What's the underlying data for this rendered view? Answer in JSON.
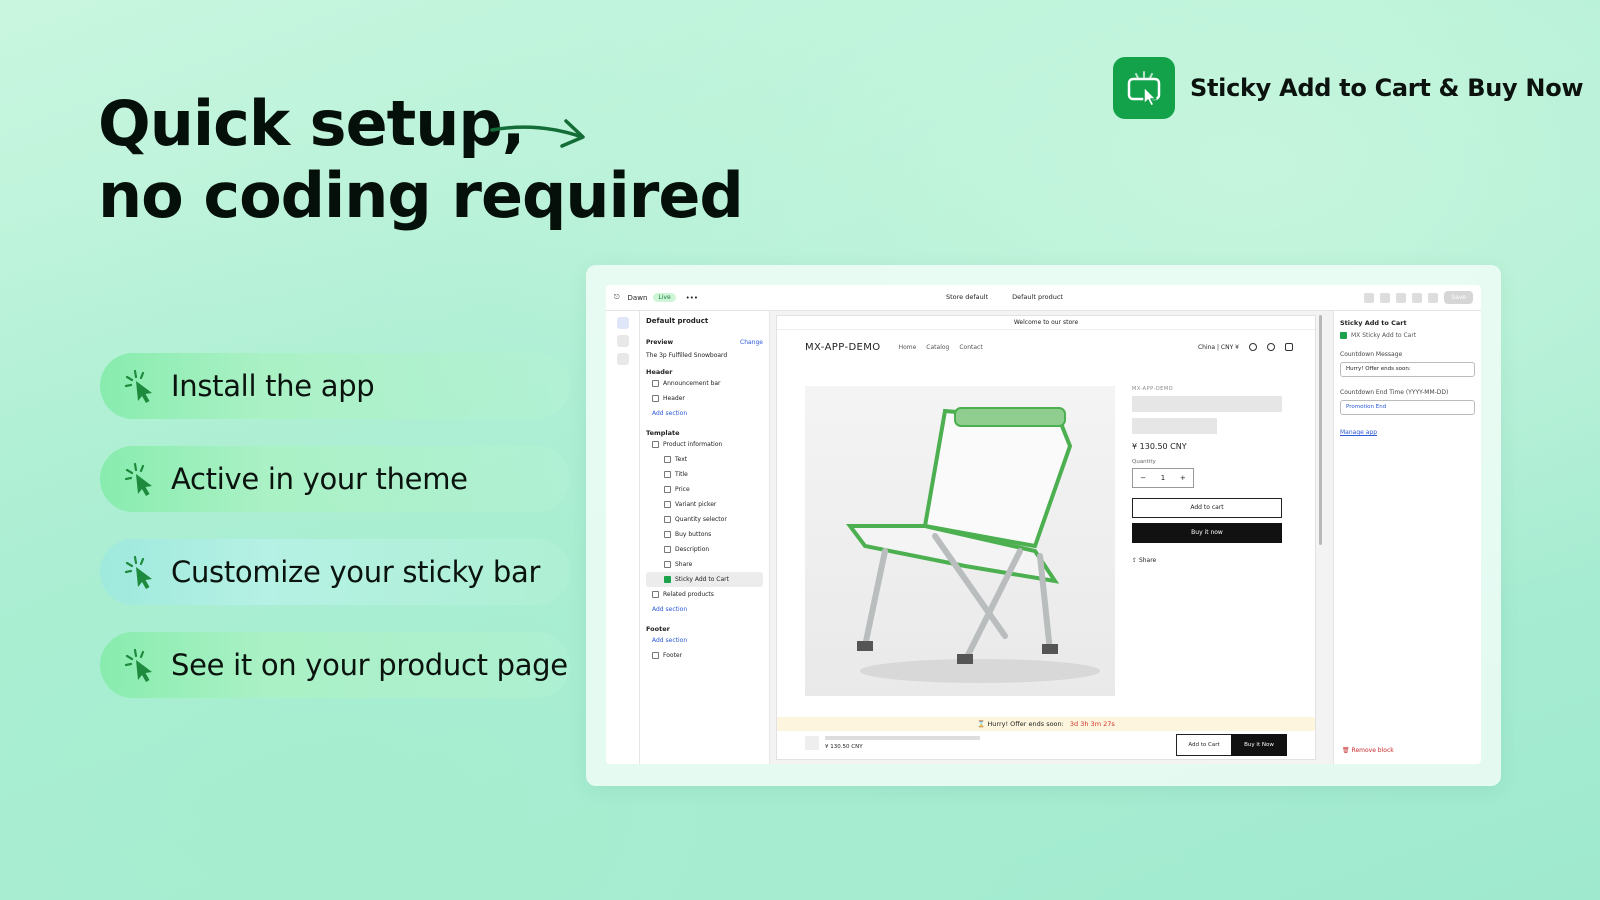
{
  "brand": {
    "logo_icon": "cursor-click-icon",
    "name": "Sticky Add to Cart & Buy Now",
    "color": "#13a24a"
  },
  "headline": {
    "line1": "Quick setup,",
    "line2": "no coding required"
  },
  "steps": [
    {
      "icon": "cursor-click-icon",
      "label": "Install the app"
    },
    {
      "icon": "cursor-click-icon",
      "label": "Active in your theme"
    },
    {
      "icon": "cursor-click-icon",
      "label": "Customize your sticky bar"
    },
    {
      "icon": "cursor-click-icon",
      "label": "See it on your product page"
    }
  ],
  "editor": {
    "topbar": {
      "theme": "Dawn",
      "status": "Live",
      "store": "Store default",
      "template": "Default product",
      "save": "Save"
    },
    "sidebar": {
      "title": "Default product",
      "preview_label": "Preview",
      "preview_change": "Change",
      "preview_value": "The 3p Fulfilled Snowboard",
      "header_group": "Header",
      "header_items": [
        "Announcement bar",
        "Header"
      ],
      "add_section": "Add section",
      "template_group": "Template",
      "product_info": "Product information",
      "blocks": [
        "Text",
        "Title",
        "Price",
        "Variant picker",
        "Quantity selector",
        "Buy buttons",
        "Description",
        "Share",
        "Sticky Add to Cart"
      ],
      "related": "Related products",
      "footer_group": "Footer",
      "footer_item": "Footer"
    },
    "store": {
      "announcement": "Welcome to our store",
      "logo": "MX-APP-DEMO",
      "nav": [
        "Home",
        "Catalog",
        "Contact"
      ],
      "currency": "China | CNY ¥",
      "vendor": "MX-APP-DEMO",
      "price": "¥ 130.50 CNY",
      "quantity_label": "Quantity",
      "quantity_value": "1",
      "add_to_cart": "Add to cart",
      "buy_now": "Buy it now",
      "share": "Share"
    },
    "sticky": {
      "countdown_text": "Hurry! Offer ends soon:",
      "countdown_time": "3d 3h 3m 27s",
      "price": "¥ 130.50 CNY",
      "add_to_cart": "Add to Cart",
      "buy_now": "Buy it Now"
    },
    "settings": {
      "title": "Sticky Add to Cart",
      "app_name": "MX Sticky Add to Cart",
      "countdown_message_label": "Countdown Message",
      "countdown_message_value": "Hurry! Offer ends soon:",
      "countdown_end_label": "Countdown End Time (YYYY-MM-DD)",
      "countdown_end_value": "Promotion End",
      "manage_app": "Manage app",
      "remove_block": "Remove block"
    }
  }
}
